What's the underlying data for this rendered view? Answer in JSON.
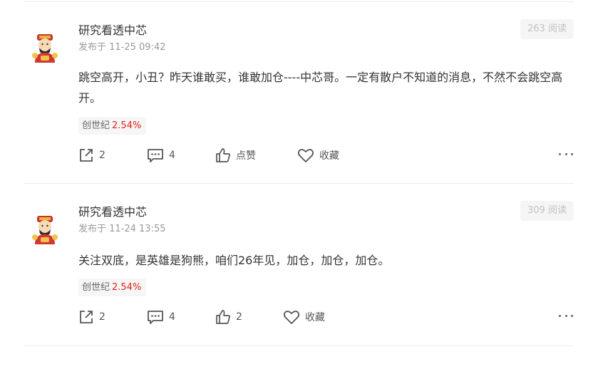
{
  "posts": [
    {
      "author": "研究看透中芯",
      "time": "发布于 11-25 09:42",
      "reads": "263 阅读",
      "content": "跳空高开，小丑？昨天谁敢买，谁敢加仓----中芯哥。一定有散户不知道的消息，不然不会跳空高开。",
      "stock_name": "创世纪",
      "stock_change": "2.54%",
      "share_count": "2",
      "comment_count": "4",
      "like_label": "点赞",
      "collect_label": "收藏"
    },
    {
      "author": "研究看透中芯",
      "time": "发布于 11-24 13:55",
      "reads": "309 阅读",
      "content": "关注双底，是英雄是狗熊，咱们26年见，加仓，加仓，加仓。",
      "stock_name": "创世纪",
      "stock_change": "2.54%",
      "share_count": "2",
      "comment_count": "4",
      "like_label": "2",
      "collect_label": "收藏"
    }
  ],
  "colors": {
    "rise": "#e2231a",
    "muted": "#999999",
    "text": "#333333"
  },
  "icons": [
    "avatar-caishen-icon",
    "share-icon",
    "comment-icon",
    "like-icon",
    "heart-icon",
    "more-icon"
  ]
}
